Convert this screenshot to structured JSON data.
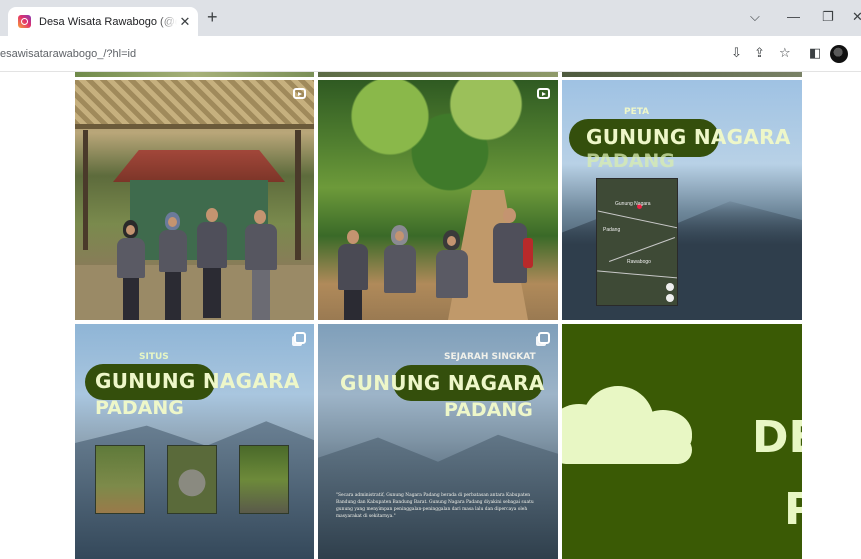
{
  "browser": {
    "tab_title": "Desa Wisata Rawabogo (@desawisatarawabogo_)",
    "tab_close": "✕",
    "new_tab": "+",
    "tab_search": "⌵",
    "minimize": "—",
    "restore": "❐",
    "close": "✕",
    "url": "esawisatarawabogo_/?hl=id",
    "toolbar": {
      "install": "⇩",
      "share": "⇪",
      "bookmark": "☆",
      "sidebar": "◧"
    }
  },
  "posts": [
    {
      "type": "photo-reel",
      "icon": "reel-icon",
      "scene": "group photo in front of wooden hut"
    },
    {
      "type": "photo-reel",
      "icon": "reel-icon",
      "scene": "group photo on forest trail"
    },
    {
      "type": "carousel",
      "small_label": "PETA",
      "title": "GUNUNG NAGARA",
      "subtitle": "PADANG",
      "map_labels": [
        "Gunung Nagara",
        "Padang",
        "Rawabogo"
      ]
    },
    {
      "type": "carousel",
      "icon": "carousel-icon",
      "small_label": "SITUS",
      "title": "GUNUNG NAGARA",
      "subtitle": "PADANG"
    },
    {
      "type": "carousel",
      "icon": "carousel-icon",
      "small_label": "SEJARAH SINGKAT",
      "title": "GUNUNG NAGARA",
      "subtitle": "PADANG",
      "quote": "\"Secara administratif, Gunung Nagara Padang berada di perbatasan antara Kabupaten Bandung dan Kabupaten Bandung Barat. Gunung Nagara Padang diyakini sebagai suatu gunung yang menyimpan peninggalan-peninggalan dari masa lalu dan dipercaya oleh masyarakat di sekitarnya.\""
    },
    {
      "type": "graphic",
      "big_text_1": "DE",
      "big_text_2": "P"
    }
  ],
  "colors": {
    "title_light": "#eef7c9",
    "pill_green": "#344f0c",
    "dark_green": "#3a5a05",
    "cream": "#e8f7c4"
  }
}
